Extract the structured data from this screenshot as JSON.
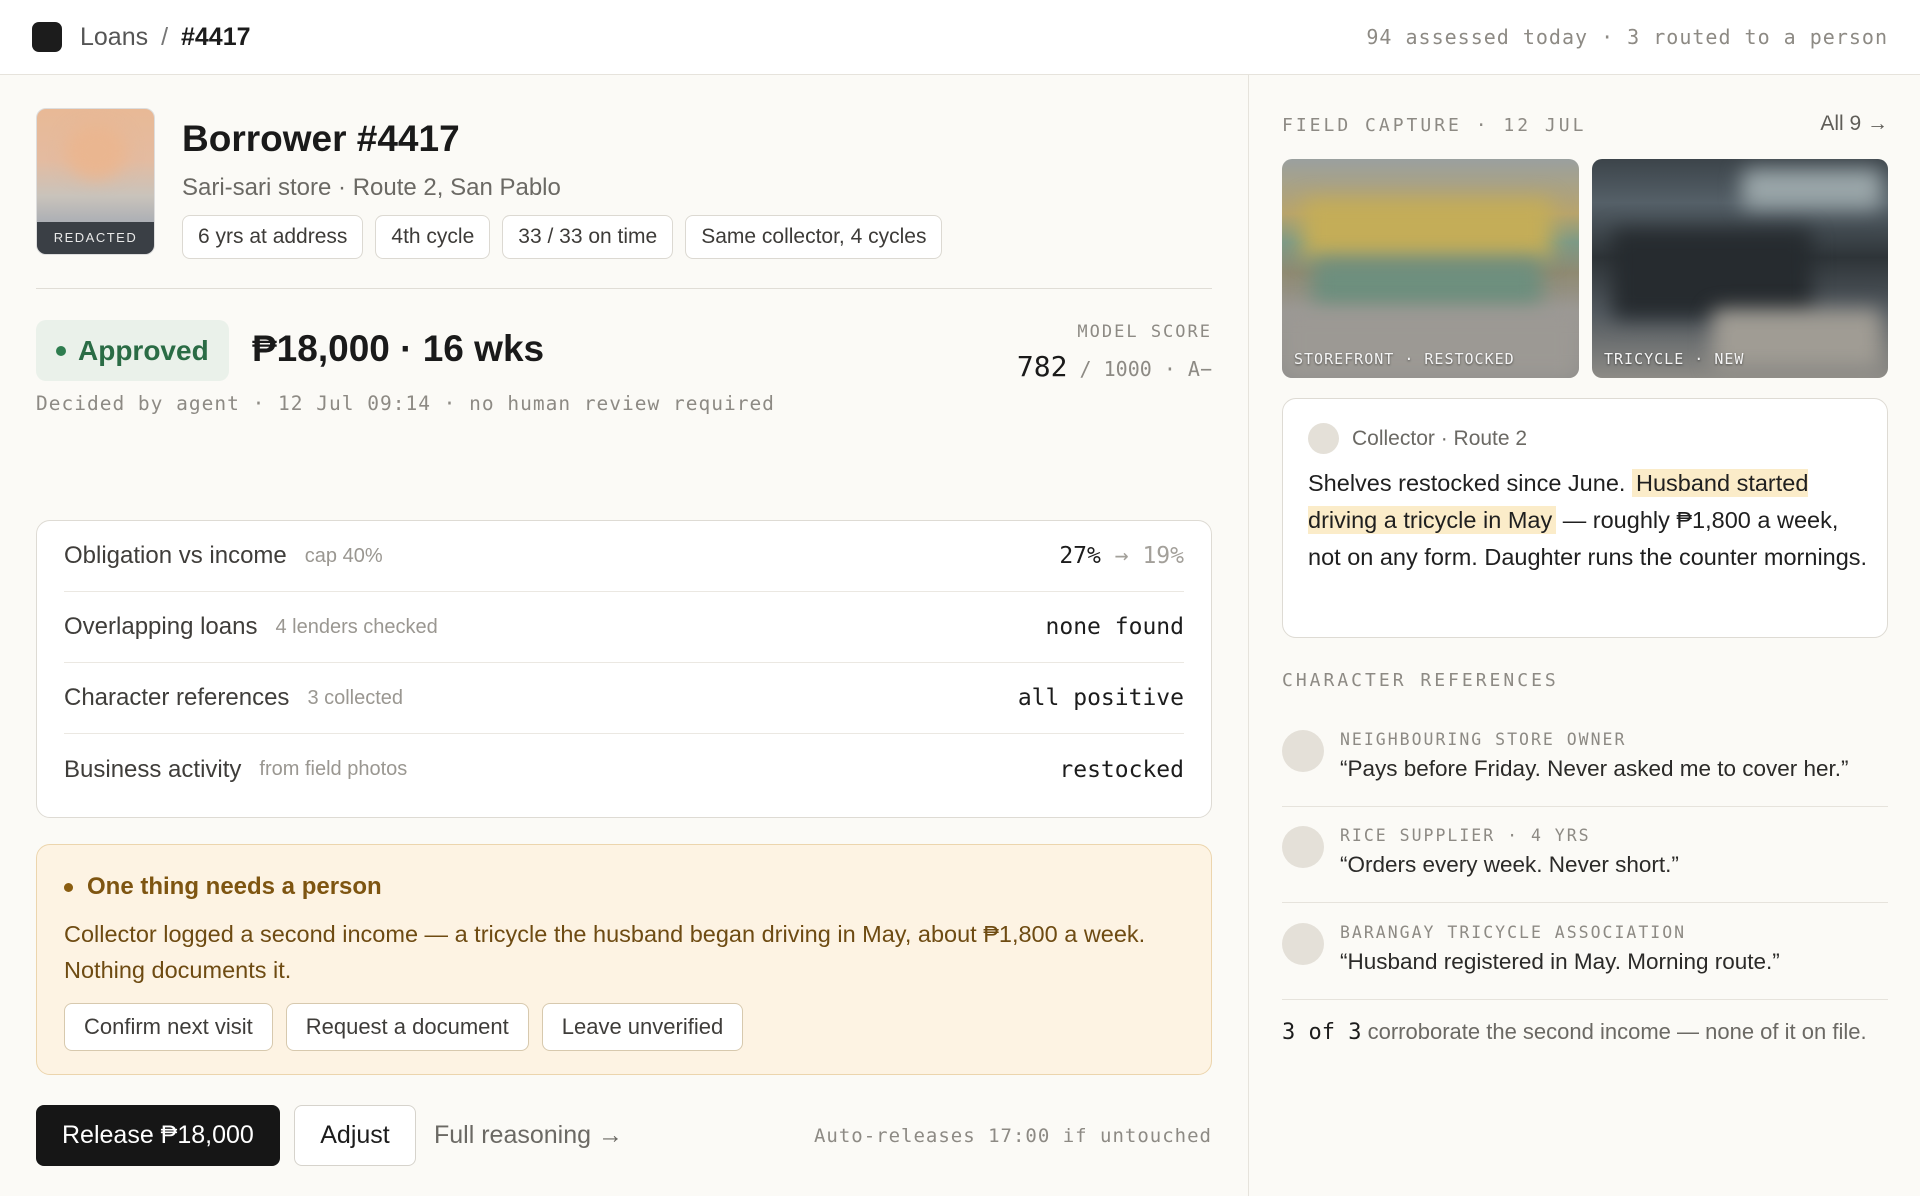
{
  "topbar": {
    "crumb_parent": "Loans",
    "crumb_sep": "/",
    "crumb_current": "#4417",
    "stats": "94 assessed today · 3 routed to a person"
  },
  "borrower": {
    "name": "Borrower #4417",
    "subtitle": "Sari-sari store · Route 2, San Pablo",
    "avatar_badge": "REDACTED",
    "tags": [
      "6 yrs at address",
      "4th cycle",
      "33 / 33 on time",
      "Same collector, 4 cycles"
    ]
  },
  "decision": {
    "status": "Approved",
    "amount": "₱18,000 · 16 wks",
    "model_score_label": "MODEL SCORE",
    "model_score": "782",
    "model_score_suffix": "/ 1000 · A−",
    "decided_by": "Decided by agent · 12 Jul 09:14 · no human review required"
  },
  "checks": [
    {
      "label": "Obligation vs income",
      "sub": "cap 40%",
      "value": "27%",
      "arrow": "→",
      "value2": "19%"
    },
    {
      "label": "Overlapping loans",
      "sub": "4 lenders checked",
      "value": "none found"
    },
    {
      "label": "Character references",
      "sub": "3 collected",
      "value": "all positive"
    },
    {
      "label": "Business activity",
      "sub": "from field photos",
      "value": "restocked"
    }
  ],
  "alert": {
    "title": "One thing needs a person",
    "body": "Collector logged a second income — a tricycle the husband began driving in May, about ₱1,800 a week. Nothing documents it.",
    "buttons": [
      "Confirm next visit",
      "Request a document",
      "Leave unverified"
    ]
  },
  "footer": {
    "release": "Release ₱18,000",
    "adjust": "Adjust",
    "full_reasoning": "Full reasoning →",
    "auto_release": "Auto-releases 17:00 if untouched"
  },
  "field_capture": {
    "label": "FIELD CAPTURE · 12 JUL",
    "all_link": "All 9 →",
    "photos": [
      "STOREFRONT · RESTOCKED",
      "TRICYCLE · NEW"
    ]
  },
  "collector_note": {
    "who": "Collector · Route 2",
    "text_1": "Shelves restocked since June.",
    "highlight": "Husband started driving a tricycle in May",
    "text_2": "— roughly ₱1,800 a week, not on any form. Daughter runs the counter mornings."
  },
  "references": {
    "label": "CHARACTER REFERENCES",
    "items": [
      {
        "who": "NEIGHBOURING STORE OWNER",
        "quote": "“Pays before Friday. Never asked me to cover her.”"
      },
      {
        "who": "RICE SUPPLIER · 4 YRS",
        "quote": "“Orders every week. Never short.”"
      },
      {
        "who": "BARANGAY TRICYCLE ASSOCIATION",
        "quote": "“Husband registered in May. Morning route.”"
      }
    ],
    "summary_count": "3 of 3",
    "summary_text": "corroborate the second income — none of it on file."
  }
}
